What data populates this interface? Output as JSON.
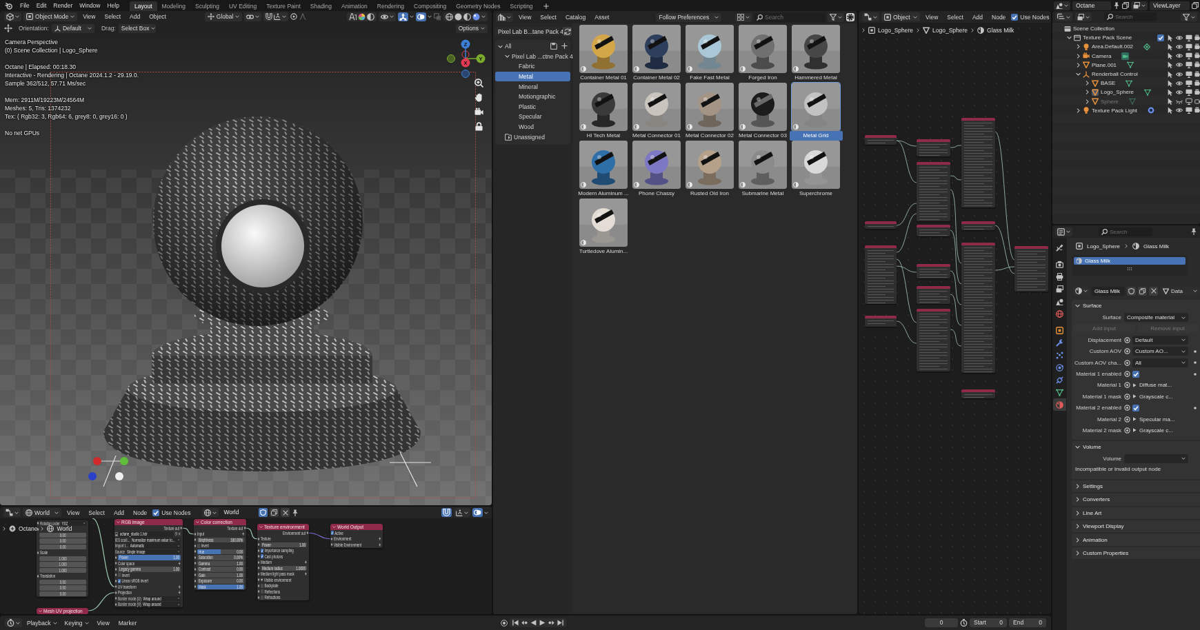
{
  "top_bar": {
    "menus": [
      "File",
      "Edit",
      "Render",
      "Window",
      "Help"
    ],
    "workspaces": [
      {
        "label": "Layout",
        "selected": true
      },
      {
        "label": "Modeling",
        "selected": false
      },
      {
        "label": "Sculpting",
        "selected": false
      },
      {
        "label": "UV Editing",
        "selected": false
      },
      {
        "label": "Texture Paint",
        "selected": false
      },
      {
        "label": "Shading",
        "selected": false
      },
      {
        "label": "Animation",
        "selected": false
      },
      {
        "label": "Rendering",
        "selected": false
      },
      {
        "label": "Compositing",
        "selected": false
      },
      {
        "label": "Geometry Nodes",
        "selected": false
      },
      {
        "label": "Scripting",
        "selected": false
      }
    ],
    "scene": "Octane",
    "view_layer": "ViewLayer"
  },
  "viewport": {
    "mode": "Object Mode",
    "menus": [
      "View",
      "Select",
      "Add",
      "Object"
    ],
    "transform_orientation": "Global",
    "gizmo_on": true,
    "overlay_on": true,
    "orientation_label": "Orientation:",
    "orientation": "Default",
    "drag_label": "Drag:",
    "drag": "Select Box",
    "options": "Options",
    "overlay_groups": [
      [
        "Camera Perspective",
        "(0) Scene Collection | Logo_Sphere"
      ],
      [
        "Octane | Elapsed: 00:18.30",
        "Interactive - Rendering | Octane 2024.1.2 - 29.19.0.",
        "Sample 362/512, 57.71 Ms/sec"
      ],
      [
        "Mem: 2911M/19223M/24564M",
        "Meshes: 5, Tris: 1374232",
        "Tex: ( Rgb32: 3, Rgb64: 6, grey8: 0, grey16: 0 )"
      ],
      [
        "No net GPUs"
      ]
    ],
    "gizmo_axes": [
      {
        "label": "Z",
        "color": "#3d7fd6"
      },
      {
        "label": "Y",
        "color": "#7bab2b"
      },
      {
        "label": "X",
        "color": "#e43b52"
      }
    ]
  },
  "world_editor": {
    "shader_type": "World",
    "menus": [
      "View",
      "Select",
      "Add",
      "Node"
    ],
    "use_nodes": {
      "label": "Use Nodes",
      "checked": true
    },
    "world": "World",
    "fake_user": true,
    "snap_on": true,
    "overlay_on": true,
    "breadcrumb": [
      "Octane",
      "World"
    ],
    "nodes": [
      {
        "rows": [
          {
            "kind": "dropdown",
            "label": "Rotation order",
            "value": "YXZ",
            "socket": true
          },
          {
            "kind": "socket",
            "socket": true
          },
          {
            "kind": "value",
            "value": "0.00",
            "socket": false
          },
          {
            "kind": "value",
            "value": "0.00",
            "socket": false
          },
          {
            "kind": "value",
            "value": "0.00",
            "socket": false
          },
          {
            "kind": "label",
            "label": "Scale",
            "socket": true
          },
          {
            "kind": "value",
            "value": "1.000",
            "socket": false
          },
          {
            "kind": "value",
            "value": "1.000",
            "socket": false
          },
          {
            "kind": "value",
            "value": "1.000",
            "socket": false
          },
          {
            "kind": "label",
            "label": "Translation",
            "socket": true
          },
          {
            "kind": "value",
            "value": "0.00",
            "socket": false
          },
          {
            "kind": "value",
            "value": "0.00",
            "socket": false
          },
          {
            "kind": "value",
            "value": "0.00",
            "socket": false
          }
        ]
      },
      {
        "title": "RGB image",
        "rows": [
          {
            "kind": "output",
            "label": "Texture out",
            "socket": true
          },
          {
            "kind": "file",
            "value": "octane_studio 1.hdr",
            "socket": false
          },
          {
            "kind": "dropdown",
            "label": "IES scali...",
            "value": "Normalize maximum value to...",
            "socket": false
          },
          {
            "kind": "dropdown",
            "label": "Import t...",
            "value": "Automatic",
            "socket": false
          },
          {
            "kind": "dropdown",
            "label": "Source",
            "value": "Single Image",
            "socket": false
          },
          {
            "kind": "slider",
            "label": "Power",
            "value": "1.00",
            "level": 1,
            "socket": true
          },
          {
            "kind": "input_plus",
            "label": "Color space",
            "socket": true
          },
          {
            "kind": "field",
            "label": "Legacy gamma",
            "value": "1.00",
            "socket": true
          },
          {
            "kind": "checkbox",
            "label": "Invert",
            "checked": false,
            "socket": true
          },
          {
            "kind": "checkbox",
            "label": "Linear sRGB invert",
            "checked": true,
            "socket": true
          },
          {
            "kind": "input_plus",
            "label": "UV transform",
            "socket": true
          },
          {
            "kind": "input_plus",
            "label": "Projection",
            "socket": true
          },
          {
            "kind": "dropdown",
            "label": "Border mode (U)",
            "value": "Wrap around",
            "socket": true
          },
          {
            "kind": "dropdown",
            "label": "Border mode (V)",
            "value": "Wrap around",
            "socket": true
          }
        ]
      },
      {
        "title": "Color correction",
        "rows": [
          {
            "kind": "output",
            "label": "Texture out",
            "socket": true
          },
          {
            "kind": "input_plus",
            "label": "Input",
            "socket": true
          },
          {
            "kind": "field",
            "label": "Brightness",
            "value": "100.00%",
            "socket": true
          },
          {
            "kind": "checkbox",
            "label": "Invert",
            "checked": false,
            "socket": true
          },
          {
            "kind": "slider",
            "label": "Hue",
            "value": "0.00",
            "level": 0.5,
            "socket": true
          },
          {
            "kind": "field",
            "label": "Saturation",
            "value": "0.00%",
            "socket": true
          },
          {
            "kind": "field",
            "label": "Gamma",
            "value": "1.00",
            "socket": true
          },
          {
            "kind": "field",
            "label": "Contrast",
            "value": "0.00",
            "socket": true
          },
          {
            "kind": "field",
            "label": "Gain",
            "value": "1.00",
            "socket": true
          },
          {
            "kind": "field",
            "label": "Exposure",
            "value": "0.00",
            "socket": true
          },
          {
            "kind": "slider",
            "label": "Mask",
            "value": "1.00",
            "level": 1,
            "socket": true
          }
        ]
      },
      {
        "title": "Texture environment",
        "rows": [
          {
            "kind": "output",
            "label": "Environment out",
            "socket": true
          },
          {
            "kind": "input",
            "label": "Texture",
            "socket": true
          },
          {
            "kind": "field",
            "label": "Power",
            "value": "1.00",
            "socket": true
          },
          {
            "kind": "checkbox",
            "label": "Importance sampling",
            "checked": true,
            "socket": true
          },
          {
            "kind": "checkbox",
            "label": "Cast photons",
            "checked": true,
            "socket": true
          },
          {
            "kind": "input_plus",
            "label": "Medium",
            "socket": true
          },
          {
            "kind": "field",
            "label": "Medium radius",
            "value": "1.0000",
            "socket": true
          },
          {
            "kind": "input_plus",
            "label": "Medium light pass mask",
            "socket": true
          },
          {
            "kind": "panel",
            "label": "Visible environment",
            "socket": true
          },
          {
            "kind": "checkbox",
            "label": "Backplate",
            "checked": false,
            "socket": true
          },
          {
            "kind": "checkbox",
            "label": "Reflections",
            "checked": false,
            "socket": true
          },
          {
            "kind": "checkbox",
            "label": "Refractions",
            "checked": false,
            "socket": true
          }
        ]
      },
      {
        "title": "World Output",
        "rows": [
          {
            "kind": "checkbox",
            "label": "Active",
            "checked": true,
            "socket": false
          },
          {
            "kind": "input_plus",
            "label": "Environment",
            "socket": true
          },
          {
            "kind": "input_plus",
            "label": "Visible Environment",
            "socket": true
          }
        ]
      },
      {
        "title": "Mesh UV projection"
      }
    ]
  },
  "asset_browser": {
    "menus": [
      "View",
      "Select",
      "Catalog",
      "Asset"
    ],
    "import_method": "Follow Preferences",
    "search": {
      "placeholder": "Search"
    },
    "library": "Pixel Lab B...tane Pack 4",
    "catalog_tree": [
      {
        "label": "All",
        "selected": false,
        "expanded": true,
        "children": [
          {
            "label": "Pixel Lab ...ctne Pack 4",
            "selected": false,
            "expanded": true,
            "children": [
              {
                "label": "Fabric",
                "selected": false
              },
              {
                "label": "Metal",
                "selected": true
              },
              {
                "label": "Mineral",
                "selected": false
              },
              {
                "label": "Motiongraphic",
                "selected": false
              },
              {
                "label": "Plastic",
                "selected": false
              },
              {
                "label": "Specular",
                "selected": false
              },
              {
                "label": "Wood",
                "selected": false
              }
            ]
          }
        ]
      }
    ],
    "unassigned": {
      "label": "Unassigned",
      "selected": false
    },
    "assets": [
      {
        "name": "Container Metal 01",
        "color": "#d4a64a",
        "selected": false
      },
      {
        "name": "Container Metal 02",
        "color": "#2e3f5e",
        "selected": false
      },
      {
        "name": "Fake Fast Metal",
        "color": "#a9c7d6",
        "selected": false
      },
      {
        "name": "Forged Iron",
        "color": "#707070",
        "selected": false
      },
      {
        "name": "Hammered Metal",
        "color": "#474747",
        "selected": false
      },
      {
        "name": "Hi Tech Metal",
        "color": "#3a3a3a",
        "selected": false
      },
      {
        "name": "Metal Connector 01",
        "color": "#c9c4bd",
        "selected": false
      },
      {
        "name": "Metal Connector 02",
        "color": "#a39486",
        "selected": false
      },
      {
        "name": "Metal Connector 03",
        "color": "#1c1c1c",
        "selected": false
      },
      {
        "name": "Metal Grid",
        "color": "#c2c2c2",
        "selected": true
      },
      {
        "name": "Modern Aluminum ...",
        "color": "#2f6fa8",
        "selected": false
      },
      {
        "name": "Phone Chassy",
        "color": "#7c78c4",
        "selected": false
      },
      {
        "name": "Rusted Old Iron",
        "color": "#b5a08a",
        "selected": false
      },
      {
        "name": "Submarine Metal",
        "color": "#8a8a8a",
        "selected": false
      },
      {
        "name": "Superchrome",
        "color": "#d9d9d9",
        "selected": false
      },
      {
        "name": "Turtledove Alumin...",
        "color": "#e3ddd6",
        "selected": false
      }
    ]
  },
  "shader_editor": {
    "shader_type": "Object",
    "menus": [
      "View",
      "Select",
      "Add",
      "Node"
    ],
    "use_nodes": {
      "label": "Use Nodes",
      "checked": true
    },
    "breadcrumb": [
      "Logo_Sphere",
      "Logo_Sphere",
      "Glass Milk"
    ]
  },
  "outliner": {
    "search": {
      "placeholder": "Search"
    },
    "tree": [
      {
        "label": "Scene Collection",
        "kind": "scene_collection",
        "selected": false,
        "children": [
          {
            "label": "Texture Pack Scene",
            "kind": "collection",
            "expanded": true,
            "checked": true,
            "selected": false,
            "visible": true,
            "children": [
              {
                "label": "Area.Default.002",
                "kind": "area_light",
                "expanded": false,
                "selected": false,
                "visible": true
              },
              {
                "label": "Camera",
                "kind": "camera",
                "expanded": false,
                "selected": false,
                "visible": true
              },
              {
                "label": "Plane.001",
                "kind": "mesh",
                "expanded": false,
                "selected": false,
                "visible": true
              },
              {
                "label": "Renderball Control",
                "kind": "empty",
                "expanded": true,
                "selected": false,
                "visible": true,
                "children": [
                  {
                    "label": "BASE",
                    "kind": "mesh",
                    "expanded": false,
                    "selected": false,
                    "visible": true
                  },
                  {
                    "label": "Logo_Sphere",
                    "kind": "mesh",
                    "expanded": false,
                    "selected": true,
                    "visible": true
                  },
                  {
                    "label": "Sphere",
                    "kind": "mesh",
                    "expanded": false,
                    "selected": false,
                    "visible": false
                  }
                ]
              },
              {
                "label": "Texture Pack Light",
                "kind": "point_light",
                "expanded": false,
                "selected": false,
                "visible": true
              }
            ]
          }
        ]
      }
    ]
  },
  "properties": {
    "search": {
      "placeholder": "Search"
    },
    "tabs": [
      {
        "kind": "tool",
        "selected": false
      },
      {
        "kind": "render",
        "selected": false
      },
      {
        "kind": "output",
        "selected": false
      },
      {
        "kind": "view_layer",
        "selected": false
      },
      {
        "kind": "scene",
        "selected": false
      },
      {
        "kind": "world",
        "selected": false
      },
      {
        "kind": "object",
        "selected": false
      },
      {
        "kind": "modifiers",
        "selected": false
      },
      {
        "kind": "particles",
        "selected": false
      },
      {
        "kind": "physics",
        "selected": false
      },
      {
        "kind": "constraints",
        "selected": false
      },
      {
        "kind": "data",
        "selected": false
      },
      {
        "kind": "material",
        "selected": true
      }
    ],
    "breadcrumb": [
      "Logo_Sphere",
      "Glass Milk"
    ],
    "material_slots": [
      {
        "name": "Glass Milk",
        "selected": true
      }
    ],
    "material": {
      "name": "Glass Milk",
      "fake_user": false,
      "link": "Data"
    },
    "panels": [
      {
        "title": "Surface",
        "expanded": true,
        "rows": [
          {
            "kind": "dropdown",
            "label": "Surface",
            "value": "Composite material",
            "socket": false,
            "animatable": false
          },
          {
            "kind": "buttons",
            "buttons": [
              {
                "label": "Add input",
                "disabled": true
              },
              {
                "label": "Remove input",
                "disabled": true
              }
            ]
          },
          {
            "kind": "dropdown",
            "label": "Displacement",
            "value": "Default",
            "socket": true,
            "animatable": false
          },
          {
            "kind": "dropdown",
            "label": "Custom AOV",
            "value": "Custom AO...",
            "socket": true,
            "animatable": true
          },
          {
            "kind": "dropdown",
            "label": "Custom AOV cha...",
            "value": "All",
            "socket": true,
            "animatable": true
          },
          {
            "kind": "checkbox",
            "label": "Material 1 enabled",
            "checked": true,
            "socket": true,
            "animatable": true
          },
          {
            "kind": "link",
            "label": "Material 1",
            "value": "Diffuse mat...",
            "socket": true,
            "animatable": false
          },
          {
            "kind": "link",
            "label": "Material 1 mask",
            "value": "Grayscale c...",
            "socket": true,
            "animatable": false
          },
          {
            "kind": "checkbox",
            "label": "Material 2 enabled",
            "checked": true,
            "socket": true,
            "animatable": true
          },
          {
            "kind": "link",
            "label": "Material 2",
            "value": "Specular ma...",
            "socket": true,
            "animatable": false
          },
          {
            "kind": "link",
            "label": "Material 2 mask",
            "value": "Grayscale c...",
            "socket": true,
            "animatable": false
          }
        ]
      },
      {
        "title": "Volume",
        "expanded": true,
        "rows": [
          {
            "kind": "dropdown",
            "label": "Volume",
            "socket": false,
            "animatable": false
          },
          {
            "kind": "note",
            "text": "Incompatible or invalid output node"
          }
        ]
      },
      {
        "title": "Settings",
        "expanded": false
      },
      {
        "title": "Converters",
        "expanded": false
      },
      {
        "title": "Line Art",
        "expanded": false
      },
      {
        "title": "Viewport Display",
        "expanded": false
      },
      {
        "title": "Animation",
        "expanded": false
      },
      {
        "title": "Custom Properties",
        "expanded": false
      }
    ]
  },
  "timeline": {
    "menus": [
      {
        "label": "Playback",
        "kind": "popover"
      },
      {
        "label": "Keying",
        "kind": "popover"
      },
      {
        "label": "View",
        "kind": "menu"
      },
      {
        "label": "Marker",
        "kind": "menu"
      }
    ],
    "frame": "0",
    "start_label": "Start",
    "start": "0",
    "end_label": "End",
    "end": "0"
  }
}
